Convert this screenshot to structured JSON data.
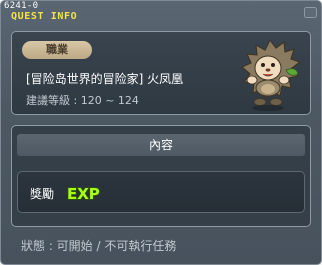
{
  "window": {
    "quest_id": "6241-0",
    "title": "QUEST INFO"
  },
  "info": {
    "job_badge": "職業",
    "quest_name": "[冒险岛世界的冒险家] 火凤凰",
    "level": "建議等級 : 120 ~ 124",
    "npc_icon": "hedgehog-npc-icon"
  },
  "content": {
    "header": "內容",
    "reward_label": "獎勵",
    "reward_badge": "EXP"
  },
  "status": "狀態 : 可開始 / 不可執行任務",
  "colors": {
    "title": "#f2e24a",
    "exp": "#a8ff1a",
    "badge": "#cbb893"
  }
}
